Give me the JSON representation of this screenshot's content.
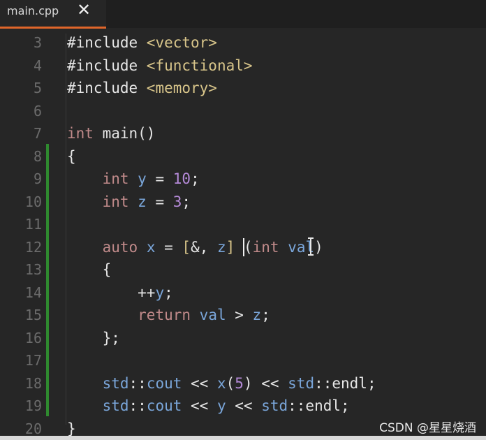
{
  "tab": {
    "filename": "main.cpp",
    "close_glyph": "✕"
  },
  "editor": {
    "line_numbers": [
      "3",
      "4",
      "5",
      "6",
      "7",
      "8",
      "9",
      "10",
      "11",
      "12",
      "13",
      "14",
      "15",
      "16",
      "17",
      "18",
      "19",
      "20"
    ],
    "lines": [
      [
        {
          "t": "#include ",
          "c": "plain"
        },
        {
          "t": "<vector>",
          "c": "str"
        }
      ],
      [
        {
          "t": "#include ",
          "c": "plain"
        },
        {
          "t": "<functional>",
          "c": "str"
        }
      ],
      [
        {
          "t": "#include ",
          "c": "plain"
        },
        {
          "t": "<memory>",
          "c": "str"
        }
      ],
      [],
      [
        {
          "t": "int",
          "c": "kw"
        },
        {
          "t": " main()",
          "c": "plain"
        }
      ],
      [
        {
          "t": "{",
          "c": "plain"
        }
      ],
      [
        {
          "t": "    ",
          "c": "plain"
        },
        {
          "t": "int",
          "c": "kw"
        },
        {
          "t": " ",
          "c": "plain"
        },
        {
          "t": "y",
          "c": "id"
        },
        {
          "t": " = ",
          "c": "plain"
        },
        {
          "t": "10",
          "c": "num"
        },
        {
          "t": ";",
          "c": "plain"
        }
      ],
      [
        {
          "t": "    ",
          "c": "plain"
        },
        {
          "t": "int",
          "c": "kw"
        },
        {
          "t": " ",
          "c": "plain"
        },
        {
          "t": "z",
          "c": "id"
        },
        {
          "t": " = ",
          "c": "plain"
        },
        {
          "t": "3",
          "c": "num"
        },
        {
          "t": ";",
          "c": "plain"
        }
      ],
      [],
      [
        {
          "t": "    ",
          "c": "plain"
        },
        {
          "t": "auto",
          "c": "kw"
        },
        {
          "t": " ",
          "c": "plain"
        },
        {
          "t": "x",
          "c": "id"
        },
        {
          "t": " = ",
          "c": "plain"
        },
        {
          "t": "[",
          "c": "str"
        },
        {
          "t": "&, ",
          "c": "plain"
        },
        {
          "t": "z",
          "c": "id"
        },
        {
          "t": "]",
          "c": "str"
        },
        {
          "t": " (",
          "c": "plain"
        },
        {
          "t": "int",
          "c": "kw"
        },
        {
          "t": " ",
          "c": "plain"
        },
        {
          "t": "val",
          "c": "id"
        },
        {
          "t": ")",
          "c": "plain"
        }
      ],
      [
        {
          "t": "    {",
          "c": "plain"
        }
      ],
      [
        {
          "t": "        ++",
          "c": "plain"
        },
        {
          "t": "y",
          "c": "id"
        },
        {
          "t": ";",
          "c": "plain"
        }
      ],
      [
        {
          "t": "        ",
          "c": "plain"
        },
        {
          "t": "return",
          "c": "kw"
        },
        {
          "t": " ",
          "c": "plain"
        },
        {
          "t": "val",
          "c": "id"
        },
        {
          "t": " > ",
          "c": "plain"
        },
        {
          "t": "z",
          "c": "id"
        },
        {
          "t": ";",
          "c": "plain"
        }
      ],
      [
        {
          "t": "    };",
          "c": "plain"
        }
      ],
      [],
      [
        {
          "t": "    ",
          "c": "plain"
        },
        {
          "t": "std",
          "c": "id"
        },
        {
          "t": "::",
          "c": "plain"
        },
        {
          "t": "cout",
          "c": "id"
        },
        {
          "t": " << ",
          "c": "plain"
        },
        {
          "t": "x",
          "c": "id"
        },
        {
          "t": "(",
          "c": "plain"
        },
        {
          "t": "5",
          "c": "num"
        },
        {
          "t": ") << ",
          "c": "plain"
        },
        {
          "t": "std",
          "c": "id"
        },
        {
          "t": "::endl;",
          "c": "plain"
        }
      ],
      [
        {
          "t": "    ",
          "c": "plain"
        },
        {
          "t": "std",
          "c": "id"
        },
        {
          "t": "::",
          "c": "plain"
        },
        {
          "t": "cout",
          "c": "id"
        },
        {
          "t": " << ",
          "c": "plain"
        },
        {
          "t": "y",
          "c": "id"
        },
        {
          "t": " << ",
          "c": "plain"
        },
        {
          "t": "std",
          "c": "id"
        },
        {
          "t": "::endl;",
          "c": "plain"
        }
      ],
      [
        {
          "t": "}",
          "c": "plain"
        }
      ]
    ]
  },
  "colors": {
    "tab_accent": "#e0662a",
    "modified_bar": "#2f8a2f",
    "keyword": "#c08a8a",
    "string": "#d8c58a",
    "number": "#b58ad8",
    "identifier": "#7aa6da"
  },
  "watermark": {
    "text": "CSDN @星星烧酒"
  }
}
